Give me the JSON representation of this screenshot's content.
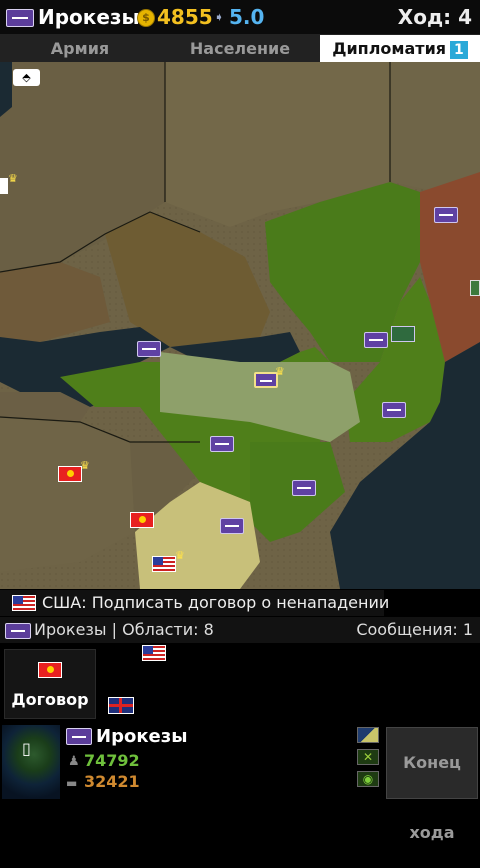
{
  "header": {
    "nation": "Ирокезы",
    "gold": "4855",
    "income": "5.0",
    "turn": "Ход: 4"
  },
  "tabs": {
    "army": "Армия",
    "population": "Население",
    "diplomacy": "Дипломатия",
    "diplomacy_badge": "1"
  },
  "message": {
    "text": "США: Подписать договор о ненападении"
  },
  "status": {
    "left": "Ирокезы | Области: 8",
    "messages": "Сообщения: 1"
  },
  "treaty_button": {
    "label": "Договор"
  },
  "info": {
    "nation": "Ирокезы",
    "population": "74792",
    "army": "32421"
  },
  "end_turn": {
    "label": "Конец хода"
  },
  "colors": {
    "iroquois": "#4f7f1a",
    "gold": "#f3c020",
    "income": "#55b4f0",
    "population": "#6fc03c",
    "army": "#d08a30"
  },
  "icons": [
    "iroquois-flag",
    "coin-icon",
    "income-arrow-icon",
    "crown-icon",
    "japan-flag",
    "usa-flag",
    "uk-flag",
    "globe-icon",
    "people-icon",
    "army-icon",
    "toggle-icon",
    "map-mode-icon"
  ]
}
